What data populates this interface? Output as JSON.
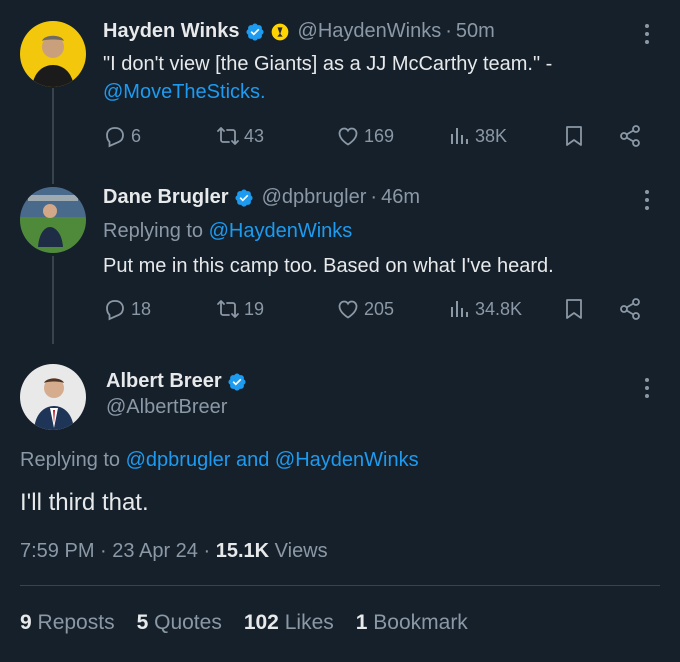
{
  "tweets": [
    {
      "name": "Hayden Winks",
      "handle": "@HaydenWinks",
      "time": "50m",
      "text": "\"I don't view [the Giants] as a JJ McCarthy team.\" -",
      "mention": "@MoveTheSticks.",
      "counts": {
        "reply": "6",
        "repost": "43",
        "like": "169",
        "views": "38K"
      }
    },
    {
      "name": "Dane Brugler",
      "handle": "@dpbrugler",
      "time": "46m",
      "replying_prefix": "Replying to",
      "replying_to": "@HaydenWinks",
      "text": "Put me in this camp too. Based on what I've heard.",
      "counts": {
        "reply": "18",
        "repost": "19",
        "like": "205",
        "views": "34.8K"
      }
    }
  ],
  "main": {
    "name": "Albert Breer",
    "handle": "@AlbertBreer",
    "replying_prefix": "Replying to",
    "replying_to": "@dpbrugler and @HaydenWinks",
    "text": "I'll third that.",
    "time": "7:59 PM",
    "date": "23 Apr 24",
    "views_count": "15.1K",
    "views_label": "Views"
  },
  "stats": [
    {
      "count": "9",
      "label": "Reposts"
    },
    {
      "count": "5",
      "label": "Quotes"
    },
    {
      "count": "102",
      "label": "Likes"
    },
    {
      "count": "1",
      "label": "Bookmark"
    }
  ],
  "colors": {
    "background": "#15202b",
    "accent": "#1d9bf0",
    "muted": "#8b98a5",
    "text": "#e7e9ea"
  }
}
